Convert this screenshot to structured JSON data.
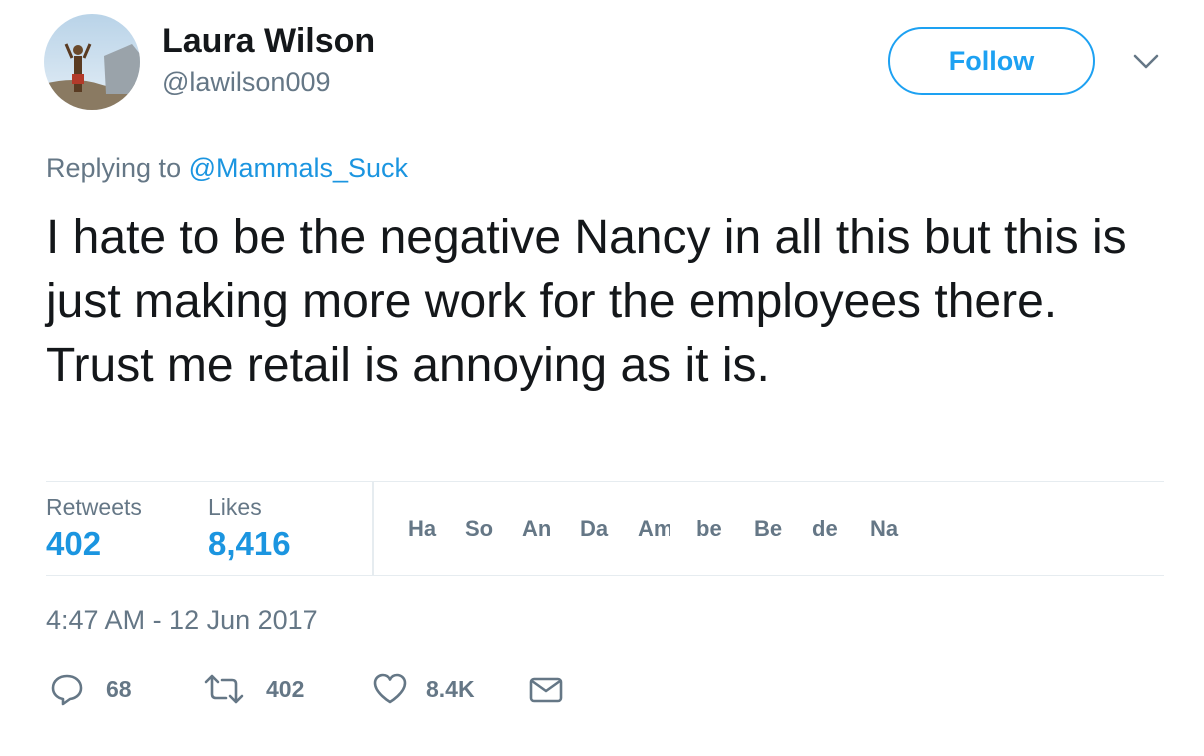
{
  "author": {
    "name": "Laura Wilson",
    "handle": "@lawilson009"
  },
  "follow_label": "Follow",
  "reply_context": {
    "prefix": "Replying to ",
    "mention": "@Mammals_Suck"
  },
  "tweet": {
    "text": "I hate to be the negative Nancy in all this but this is just making more work for the employees there. Trust me retail is annoying as it is.",
    "timestamp": "4:47 AM - 12 Jun 2017"
  },
  "stats": {
    "retweets_label": "Retweets",
    "retweets_value": "402",
    "likes_label": "Likes",
    "likes_value": "8,416"
  },
  "likers": [
    "Ha",
    "So",
    "An",
    "Da",
    "Am",
    "be",
    "Be",
    "de",
    "Na"
  ],
  "actions": {
    "reply_count": "68",
    "retweet_count": "402",
    "like_count": "8.4K"
  },
  "icons": {
    "reply": "reply-icon",
    "retweet": "retweet-icon",
    "like": "heart-icon",
    "dm": "envelope-icon",
    "caret": "chevron-down-icon"
  },
  "colors": {
    "accent": "#1da1f2",
    "link": "#1b95e0",
    "secondary_text": "#657786",
    "primary_text": "#14171a",
    "divider": "#e6ecf0"
  }
}
